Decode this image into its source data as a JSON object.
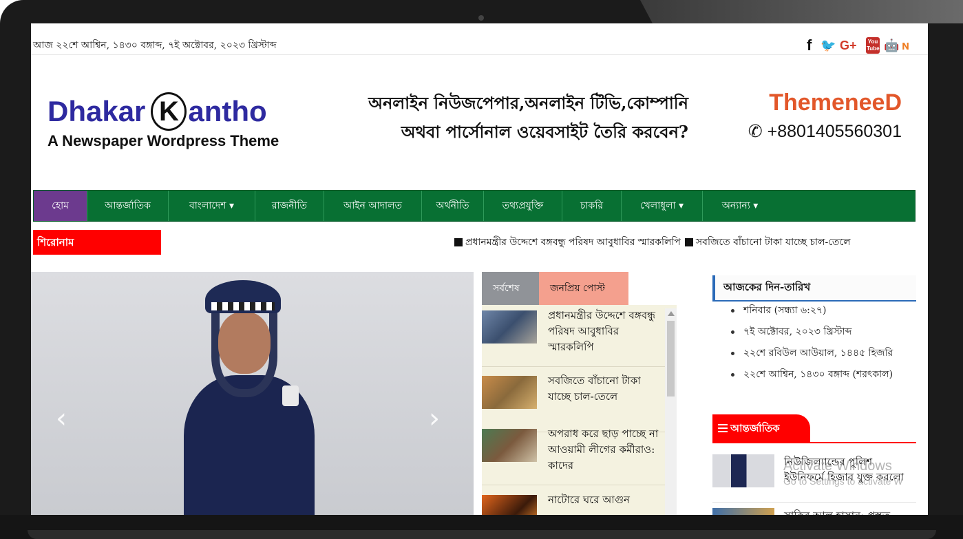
{
  "topbar": {
    "date_text": "আজ ২২শে আশ্বিন, ১৪৩০ বঙ্গাব্দ, ৭ই অক্টোবর, ২০২৩ খ্রিস্টাব্দ",
    "social": [
      {
        "icon": "facebook-icon",
        "glyph": "f"
      },
      {
        "icon": "twitter-icon",
        "glyph": "🐦"
      },
      {
        "icon": "google-plus-icon",
        "glyph": "G+"
      },
      {
        "icon": "youtube-icon",
        "glyph": "You Tube"
      },
      {
        "icon": "android-icon",
        "glyph": "🤖"
      },
      {
        "icon": "rss-icon",
        "glyph": "ɴ"
      }
    ]
  },
  "logo": {
    "part1": "Dhakar",
    "k": "K",
    "part2": "antho",
    "tagline": "A Newspaper Wordpress Theme"
  },
  "ad": {
    "line1": "অনলাইন নিউজপেপার,অনলাইন টিভি,কোম্পানি",
    "line2": "অথবা পার্সোনাল ওয়েবসাইট তৈরি করবেন?",
    "brand": "ThemeneeD",
    "phone": "+8801405560301"
  },
  "nav": {
    "items": [
      {
        "label": "হোম",
        "active": true
      },
      {
        "label": "আন্তর্জাতিক"
      },
      {
        "label": "বাংলাদেশ ▾"
      },
      {
        "label": "রাজনীতি"
      },
      {
        "label": "আইন আদালত"
      },
      {
        "label": "অর্থনীতি"
      },
      {
        "label": "তথ্যপ্রযুক্তি"
      },
      {
        "label": "চাকরি"
      },
      {
        "label": "খেলাধুলা ▾"
      },
      {
        "label": "অন্যান্য ▾"
      }
    ]
  },
  "ticker": {
    "label": "শিরোনাম",
    "items": [
      "প্রধানমন্ত্রীর উদ্দেশে বঙ্গবন্ধু পরিষদ আবুধাবির স্মারকলিপি",
      "সবজিতে বাঁচানো টাকা যাচ্ছে চাল-তেলে"
    ]
  },
  "slider": {
    "prev": "‹",
    "next": "›"
  },
  "tabs": {
    "latest": "সর্বশেষ",
    "popular": "জনপ্রিয় পোস্ট"
  },
  "posts": [
    {
      "title": "প্রধানমন্ত্রীর উদ্দেশে বঙ্গবন্ধু পরিষদ আবুধাবির স্মারকলিপি"
    },
    {
      "title": "সবজিতে বাঁচানো টাকা যাচ্ছে চাল-তেলে"
    },
    {
      "title": "অপরাধ করে ছাড় পাচ্ছে না আওয়ামী লীগের কর্মীরাও: কাদের"
    },
    {
      "title": "নাটোরে ঘরে আগুন"
    }
  ],
  "sidebar": {
    "date_title": "আজকের দিন-তারিখ",
    "dates": [
      "শনিবার (সন্ধ্যা ৬:২৭)",
      "৭ই অক্টোবর, ২০২৩ খ্রিস্টাব্দ",
      "২২শে রবিউল আউয়াল, ১৪৪৫ হিজরি",
      "২২শে আশ্বিন, ১৪৩০ বঙ্গাব্দ (শরৎকাল)"
    ],
    "intl_title": "আন্তর্জাতিক",
    "intl_news": [
      {
        "title": "নিউজিল্যান্ডের পুলিশ ইউনিফর্মে হিজাব যুক্ত করলো"
      },
      {
        "title": "সাকিব আল হাসান: প্রস্তুত"
      }
    ]
  },
  "watermark": {
    "line1": "Activate Windows",
    "line2": "Go to Settings to activate W"
  },
  "colors": {
    "nav_green": "#087033",
    "nav_active": "#6c3a8e",
    "accent_red": "#ff0000",
    "logo_blue": "#2e2aa0",
    "brand_orange": "#e2572a"
  }
}
